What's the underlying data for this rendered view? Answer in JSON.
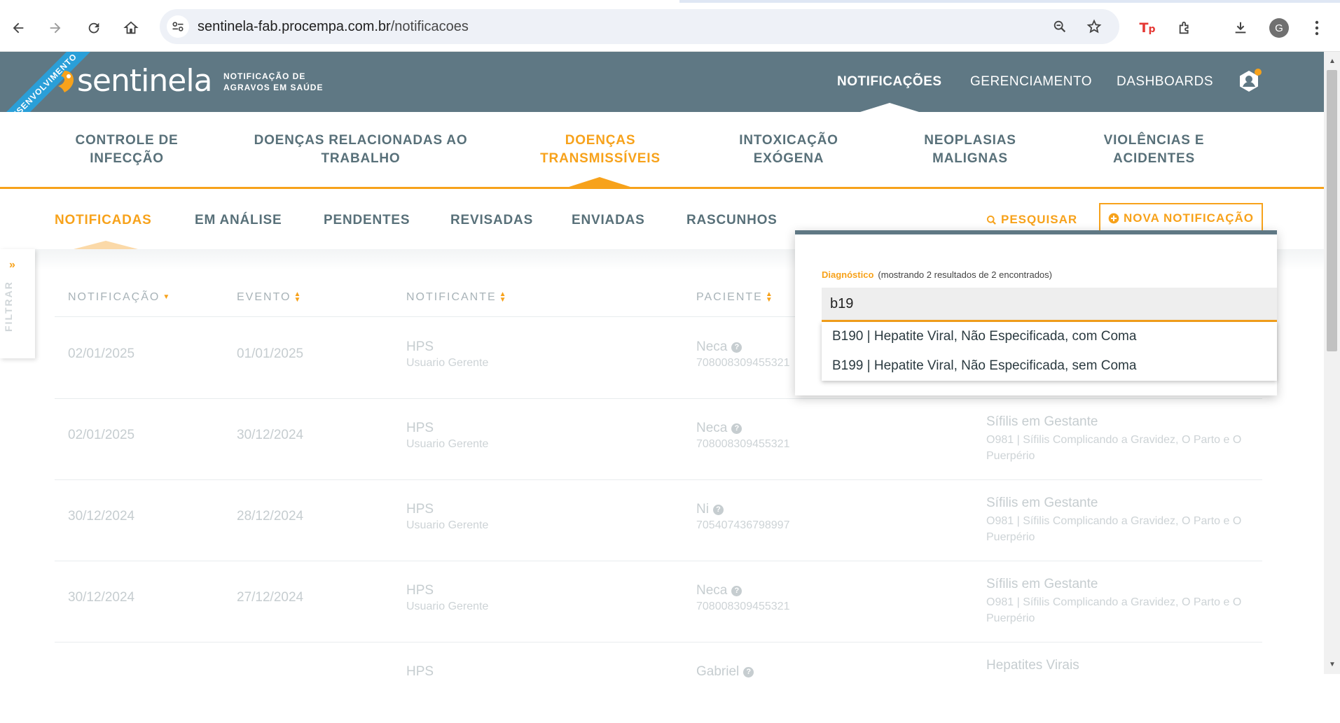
{
  "browser": {
    "url_host": "sentinela-fab.procempa.com.br",
    "url_path": "/notificacoes",
    "avatar_letter": "G",
    "icons": [
      "back-icon",
      "forward-icon",
      "reload-icon",
      "home-icon",
      "site-settings-icon",
      "zoom-icon",
      "bookmark-star-icon",
      "tp-extension-icon",
      "extensions-icon",
      "download-icon",
      "menu-icon"
    ]
  },
  "app": {
    "ribbon": "DESENVOLVIMENTO",
    "logo_text": "sentinela",
    "subtitle_line1": "NOTIFICAÇÃO DE",
    "subtitle_line2": "AGRAVOS EM SAÚDE",
    "top_nav": [
      {
        "label": "NOTIFICAÇÕES",
        "active": true
      },
      {
        "label": "GERENCIAMENTO",
        "active": false
      },
      {
        "label": "DASHBOARDS",
        "active": false
      }
    ],
    "accent_color": "#f7a21b",
    "header_color": "#5f7884"
  },
  "categories": [
    {
      "line1": "CONTROLE DE",
      "line2": "INFECÇÃO",
      "active": false
    },
    {
      "line1": "DOENÇAS RELACIONADAS AO",
      "line2": "TRABALHO",
      "active": false
    },
    {
      "line1": "DOENÇAS",
      "line2": "TRANSMISSÍVEIS",
      "active": true
    },
    {
      "line1": "INTOXICAÇÃO",
      "line2": "EXÓGENA",
      "active": false
    },
    {
      "line1": "NEOPLASIAS",
      "line2": "MALIGNAS",
      "active": false
    },
    {
      "line1": "VIOLÊNCIAS E",
      "line2": "ACIDENTES",
      "active": false
    }
  ],
  "tabs": [
    {
      "label": "NOTIFICADAS",
      "active": true
    },
    {
      "label": "EM ANÁLISE",
      "active": false
    },
    {
      "label": "PENDENTES",
      "active": false
    },
    {
      "label": "REVISADAS",
      "active": false
    },
    {
      "label": "ENVIADAS",
      "active": false
    },
    {
      "label": "RASCUNHOS",
      "active": false
    }
  ],
  "actions": {
    "search_label": "PESQUISAR",
    "new_label": "NOVA NOTIFICAÇÃO"
  },
  "filter_label": "FILTRAR",
  "table": {
    "headers": [
      "NOTIFICAÇÃO",
      "EVENTO",
      "NOTIFICANTE",
      "PACIENTE"
    ],
    "rows": [
      {
        "notificacao": "02/01/2025",
        "evento": "01/01/2025",
        "notificante": "HPS",
        "notificante_sub": "Usuario Gerente",
        "paciente": "Neca",
        "paciente_id": "708008309455321",
        "evento_nome": "",
        "evento_desc": ""
      },
      {
        "notificacao": "02/01/2025",
        "evento": "30/12/2024",
        "notificante": "HPS",
        "notificante_sub": "Usuario Gerente",
        "paciente": "Neca",
        "paciente_id": "708008309455321",
        "evento_nome": "Sífilis em Gestante",
        "evento_desc": "O981 | Sífilis Complicando a Gravidez, O Parto e O Puerpério"
      },
      {
        "notificacao": "30/12/2024",
        "evento": "28/12/2024",
        "notificante": "HPS",
        "notificante_sub": "Usuario Gerente",
        "paciente": "Ni",
        "paciente_id": "705407436798997",
        "evento_nome": "Sífilis em Gestante",
        "evento_desc": "O981 | Sífilis Complicando a Gravidez, O Parto e O Puerpério"
      },
      {
        "notificacao": "30/12/2024",
        "evento": "27/12/2024",
        "notificante": "HPS",
        "notificante_sub": "Usuario Gerente",
        "paciente": "Neca",
        "paciente_id": "708008309455321",
        "evento_nome": "Sífilis em Gestante",
        "evento_desc": "O981 | Sífilis Complicando a Gravidez, O Parto e O Puerpério"
      },
      {
        "notificacao": "",
        "evento": "",
        "notificante": "HPS",
        "notificante_sub": "",
        "paciente": "Gabriel",
        "paciente_id": "",
        "evento_nome": "Hepatites Virais",
        "evento_desc": ""
      }
    ]
  },
  "search_popup": {
    "field_label": "Diagnóstico",
    "result_info": "(mostrando 2 resultados de 2 encontrados)",
    "input_value": "b19",
    "results": [
      "B190 | Hepatite Viral, Não Especificada, com Coma",
      "B199 | Hepatite Viral, Não Especificada, sem Coma"
    ]
  }
}
